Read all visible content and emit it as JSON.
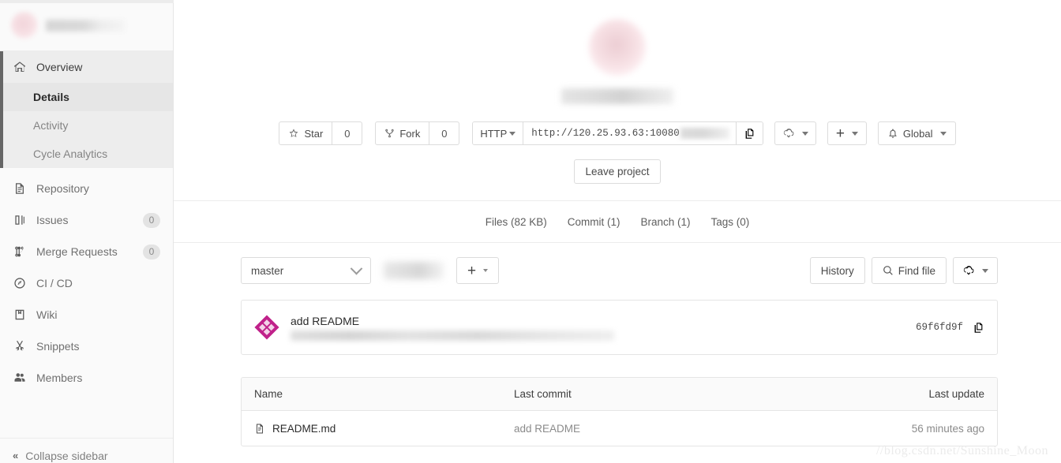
{
  "sidebar": {
    "project_name_redacted": true,
    "items": [
      {
        "label": "Overview",
        "icon": "home-icon",
        "badge": null,
        "active": true
      },
      {
        "label": "Repository",
        "icon": "document-icon",
        "badge": null,
        "active": false
      },
      {
        "label": "Issues",
        "icon": "issues-icon",
        "badge": "0",
        "active": false
      },
      {
        "label": "Merge Requests",
        "icon": "merge-request-icon",
        "badge": "0",
        "active": false
      },
      {
        "label": "CI / CD",
        "icon": "rocket-icon",
        "badge": null,
        "active": false
      },
      {
        "label": "Wiki",
        "icon": "book-icon",
        "badge": null,
        "active": false
      },
      {
        "label": "Snippets",
        "icon": "scissors-icon",
        "badge": null,
        "active": false
      },
      {
        "label": "Members",
        "icon": "users-icon",
        "badge": null,
        "active": false
      }
    ],
    "sub_items": [
      {
        "label": "Details",
        "active": true
      },
      {
        "label": "Activity",
        "active": false
      },
      {
        "label": "Cycle Analytics",
        "active": false
      }
    ],
    "collapse": {
      "label": "Collapse sidebar",
      "icon": "double-chevron-left-icon"
    }
  },
  "header": {
    "star_label": "Star",
    "star_count": "0",
    "fork_label": "Fork",
    "fork_count": "0",
    "clone_protocol": "HTTP",
    "clone_url": "http://120.25.93.63:10080",
    "copy_icon": "copy-icon",
    "download_icon": "download-cloud-icon",
    "plus_icon": "plus-icon",
    "notification_label": "Global",
    "notification_icon": "bell-icon",
    "leave_label": "Leave project"
  },
  "stats": [
    {
      "label": "Files (82 KB)"
    },
    {
      "label": "Commit (1)"
    },
    {
      "label": "Branch (1)"
    },
    {
      "label": "Tags (0)"
    }
  ],
  "toolbar": {
    "branch": "master",
    "plus_icon": "plus-icon",
    "history_label": "History",
    "find_file_label": "Find file",
    "find_file_icon": "search-icon",
    "download_icon": "download-cloud-icon"
  },
  "commit": {
    "message": "add README",
    "hash": "69f6fd9f",
    "copy_icon": "copy-icon",
    "avatar_color": "#c0218a"
  },
  "files": {
    "columns": [
      "Name",
      "Last commit",
      "Last update"
    ],
    "rows": [
      {
        "name": "README.md",
        "icon": "file-text-icon",
        "last_commit": "add README",
        "last_update": "56 minutes ago"
      }
    ]
  },
  "watermark": "//blog.csdn.net/Sunshine_Moon"
}
